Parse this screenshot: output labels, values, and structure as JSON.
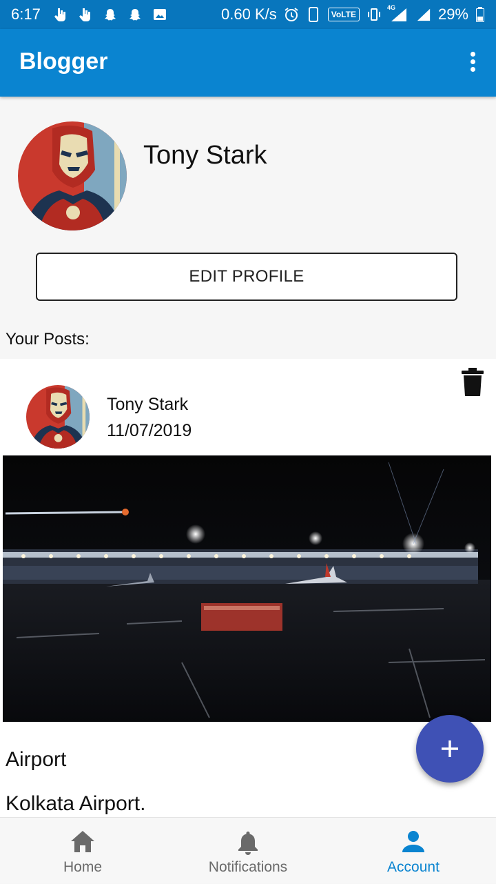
{
  "status_bar": {
    "time": "6:17",
    "net_speed": "0.60 K/s",
    "volte": "VoLTE",
    "signal_label": "4G",
    "battery": "29%"
  },
  "app_bar": {
    "title": "Blogger"
  },
  "profile": {
    "name": "Tony Stark",
    "edit_label": "EDIT PROFILE"
  },
  "posts_heading": "Your Posts:",
  "post": {
    "author": "Tony Stark",
    "date": "11/07/2019",
    "title": "Airport",
    "description": "Kolkata Airport."
  },
  "bottom_nav": {
    "items": [
      {
        "label": "Home",
        "icon": "home-icon",
        "active": false
      },
      {
        "label": "Notifications",
        "icon": "bell-icon",
        "active": false
      },
      {
        "label": "Account",
        "icon": "person-icon",
        "active": true
      }
    ]
  },
  "colors": {
    "status_bar": "#0876bd",
    "app_bar": "#0a84d0",
    "fab": "#3f51b5",
    "active_nav": "#0a84d0",
    "inactive_nav": "#6a6a6a"
  }
}
